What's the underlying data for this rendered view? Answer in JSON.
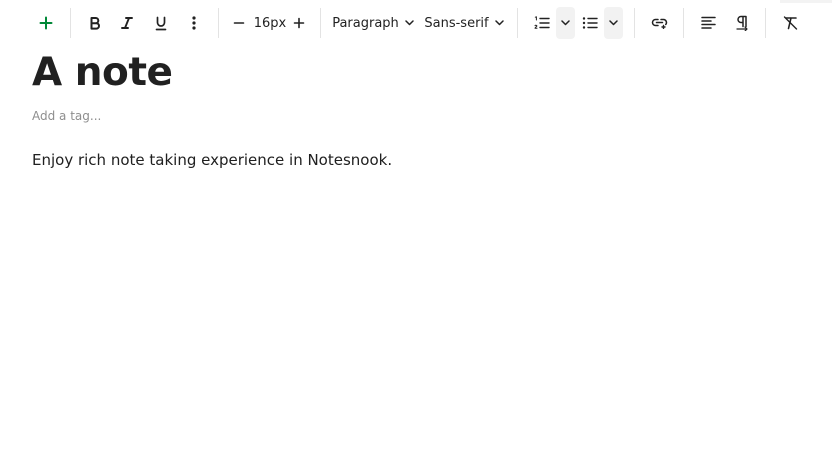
{
  "toolbar": {
    "font_size_value": "16px",
    "block_type_label": "Paragraph",
    "font_family_label": "Sans-serif"
  },
  "note": {
    "title": "A note",
    "tag_placeholder": "Add a tag...",
    "body": "Enjoy rich note taking experience in Notesnook."
  },
  "colors": {
    "accent": "#008837",
    "text": "#212121",
    "muted": "#8e8e8e",
    "separator": "#e3e3e3"
  },
  "icons": [
    "plus-icon",
    "bold-icon",
    "italic-icon",
    "underline-icon",
    "more-vertical-icon",
    "minus-icon",
    "chevron-down-icon",
    "numbered-list-icon",
    "bulleted-list-icon",
    "link-icon",
    "align-left-icon",
    "paragraph-direction-icon",
    "clear-formatting-icon"
  ]
}
